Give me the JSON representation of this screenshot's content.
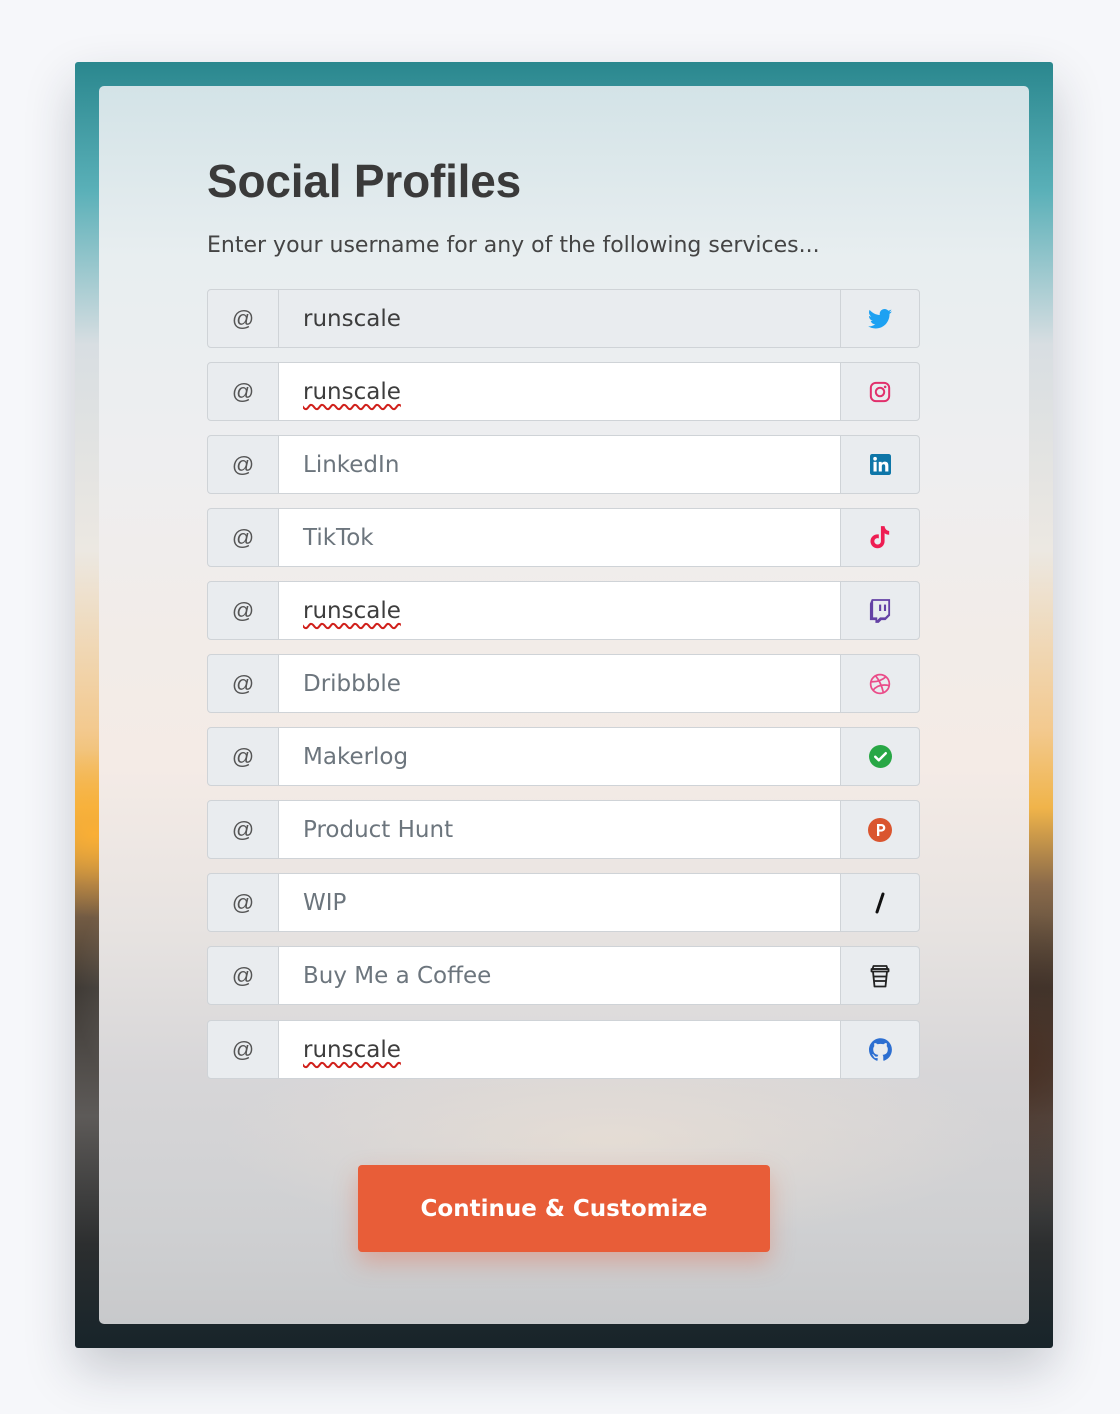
{
  "page": {
    "title": "Social Profiles",
    "subtitle": "Enter your username for any of the following services..."
  },
  "prefix_symbol": "@",
  "fields": [
    {
      "service": "Twitter",
      "value": "runscale",
      "placeholder": "",
      "disabled": true,
      "spell_error": false,
      "icon": "twitter-icon",
      "icon_color": "#1da1f2"
    },
    {
      "service": "Instagram",
      "value": "runscale",
      "placeholder": "",
      "disabled": false,
      "spell_error": true,
      "icon": "instagram-icon",
      "icon_color": "#e1306c"
    },
    {
      "service": "LinkedIn",
      "value": "",
      "placeholder": "LinkedIn",
      "disabled": false,
      "spell_error": false,
      "icon": "linkedin-icon",
      "icon_color": "#0e76a8"
    },
    {
      "service": "TikTok",
      "value": "",
      "placeholder": "TikTok",
      "disabled": false,
      "spell_error": false,
      "icon": "tiktok-icon",
      "icon_color": "#ee1d52"
    },
    {
      "service": "Twitch",
      "value": "runscale",
      "placeholder": "",
      "disabled": false,
      "spell_error": true,
      "icon": "twitch-icon",
      "icon_color": "#6441a5"
    },
    {
      "service": "Dribbble",
      "value": "",
      "placeholder": "Dribbble",
      "disabled": false,
      "spell_error": false,
      "icon": "dribbble-icon",
      "icon_color": "#ea4c89"
    },
    {
      "service": "Makerlog",
      "value": "",
      "placeholder": "Makerlog",
      "disabled": false,
      "spell_error": false,
      "icon": "makerlog-check-icon",
      "icon_color": "#28a745"
    },
    {
      "service": "Product Hunt",
      "value": "",
      "placeholder": "Product Hunt",
      "disabled": false,
      "spell_error": false,
      "icon": "product-hunt-icon",
      "icon_color": "#da552f"
    },
    {
      "service": "WIP",
      "value": "",
      "placeholder": "WIP",
      "disabled": false,
      "spell_error": false,
      "icon": "wip-slash-icon",
      "icon_color": "#111111"
    },
    {
      "service": "Buy Me a Coffee",
      "value": "",
      "placeholder": "Buy Me a Coffee",
      "disabled": false,
      "spell_error": false,
      "icon": "coffee-cup-icon",
      "icon_color": "#222222"
    },
    {
      "service": "GitHub",
      "value": "runscale",
      "placeholder": "",
      "disabled": false,
      "spell_error": true,
      "icon": "github-icon",
      "icon_color": "#2d6fd1"
    }
  ],
  "submit": {
    "label": "Continue & Customize",
    "color": "#e85d38"
  }
}
